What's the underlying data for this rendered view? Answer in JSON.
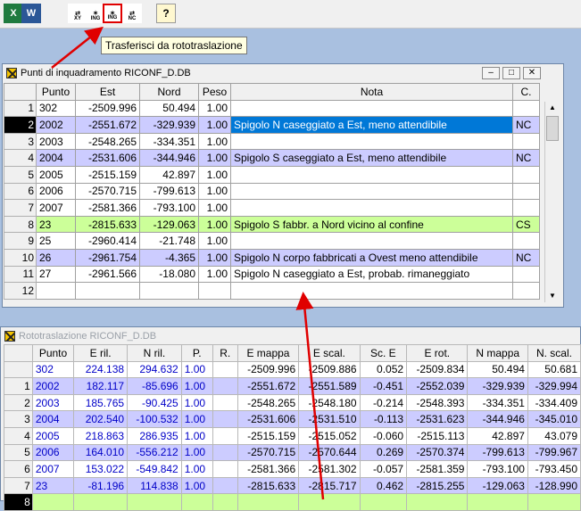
{
  "toolbar": {
    "buttons": [
      {
        "name": "excel-icon",
        "caption": "X"
      },
      {
        "name": "word-icon",
        "caption": "W"
      },
      {
        "name": "xy-icon",
        "caption": "XY"
      },
      {
        "name": "ing-icon",
        "caption": "ING"
      },
      {
        "name": "transfer-roto-icon",
        "caption": "ING"
      },
      {
        "name": "nc-icon",
        "caption": "NC"
      },
      {
        "name": "help-icon",
        "caption": "?"
      }
    ],
    "tooltip": "Trasferisci da rototraslazione"
  },
  "window1": {
    "title": "Punti di inquadramento RICONF_D.DB",
    "columns": [
      "Punto",
      "Est",
      "Nord",
      "Peso",
      "Nota",
      "C."
    ],
    "rows": [
      {
        "n": "1",
        "punto": "302",
        "est": "-2509.996",
        "nord": "50.494",
        "peso": "1.00",
        "nota": "",
        "c": ""
      },
      {
        "n": "2",
        "punto": "2002",
        "est": "-2551.672",
        "nord": "-329.939",
        "peso": "1.00",
        "nota": "Spigolo N caseggiato a Est, meno attendibile",
        "c": "NC"
      },
      {
        "n": "3",
        "punto": "2003",
        "est": "-2548.265",
        "nord": "-334.351",
        "peso": "1.00",
        "nota": "",
        "c": ""
      },
      {
        "n": "4",
        "punto": "2004",
        "est": "-2531.606",
        "nord": "-344.946",
        "peso": "1.00",
        "nota": "Spigolo S caseggiato a Est, meno attendibile",
        "c": "NC"
      },
      {
        "n": "5",
        "punto": "2005",
        "est": "-2515.159",
        "nord": "42.897",
        "peso": "1.00",
        "nota": "",
        "c": ""
      },
      {
        "n": "6",
        "punto": "2006",
        "est": "-2570.715",
        "nord": "-799.613",
        "peso": "1.00",
        "nota": "",
        "c": ""
      },
      {
        "n": "7",
        "punto": "2007",
        "est": "-2581.366",
        "nord": "-793.100",
        "peso": "1.00",
        "nota": "",
        "c": ""
      },
      {
        "n": "8",
        "punto": "23",
        "est": "-2815.633",
        "nord": "-129.063",
        "peso": "1.00",
        "nota": "Spigolo S fabbr. a Nord vicino al confine",
        "c": "CS"
      },
      {
        "n": "9",
        "punto": "25",
        "est": "-2960.414",
        "nord": "-21.748",
        "peso": "1.00",
        "nota": "",
        "c": ""
      },
      {
        "n": "10",
        "punto": "26",
        "est": "-2961.754",
        "nord": "-4.365",
        "peso": "1.00",
        "nota": "Spigolo N corpo fabbricati a Ovest meno attendibile",
        "c": "NC"
      },
      {
        "n": "11",
        "punto": "27",
        "est": "-2961.566",
        "nord": "-18.080",
        "peso": "1.00",
        "nota": "Spigolo N caseggiato a Est, probab. rimaneggiato",
        "c": ""
      },
      {
        "n": "12",
        "punto": "",
        "est": "",
        "nord": "",
        "peso": "",
        "nota": "",
        "c": ""
      }
    ]
  },
  "window2": {
    "title": "Rototraslazione RICONF_D.DB",
    "columns": [
      "Punto",
      "E ril.",
      "N ril.",
      "P.",
      "R.",
      "E mappa",
      "E scal.",
      "Sc. E",
      "E rot.",
      "N mappa",
      "N. scal."
    ],
    "rows": [
      {
        "n": "",
        "v": [
          "302",
          "224.138",
          "294.632",
          "1.00",
          "",
          "-2509.996",
          "-2509.886",
          "0.052",
          "-2509.834",
          "50.494",
          "50.681"
        ]
      },
      {
        "n": "1",
        "v": [
          "2002",
          "182.117",
          "-85.696",
          "1.00",
          "",
          "-2551.672",
          "-2551.589",
          "-0.451",
          "-2552.039",
          "-329.939",
          "-329.994"
        ]
      },
      {
        "n": "2",
        "v": [
          "2003",
          "185.765",
          "-90.425",
          "1.00",
          "",
          "-2548.265",
          "-2548.180",
          "-0.214",
          "-2548.393",
          "-334.351",
          "-334.409"
        ]
      },
      {
        "n": "3",
        "v": [
          "2004",
          "202.540",
          "-100.532",
          "1.00",
          "",
          "-2531.606",
          "-2531.510",
          "-0.113",
          "-2531.623",
          "-344.946",
          "-345.010"
        ]
      },
      {
        "n": "4",
        "v": [
          "2005",
          "218.863",
          "286.935",
          "1.00",
          "",
          "-2515.159",
          "-2515.052",
          "-0.060",
          "-2515.113",
          "42.897",
          "43.079"
        ]
      },
      {
        "n": "5",
        "v": [
          "2006",
          "164.010",
          "-556.212",
          "1.00",
          "",
          "-2570.715",
          "-2570.644",
          "0.269",
          "-2570.374",
          "-799.613",
          "-799.967"
        ]
      },
      {
        "n": "6",
        "v": [
          "2007",
          "153.022",
          "-549.842",
          "1.00",
          "",
          "-2581.366",
          "-2581.302",
          "-0.057",
          "-2581.359",
          "-793.100",
          "-793.450"
        ]
      },
      {
        "n": "7",
        "v": [
          "23",
          "-81.196",
          "114.838",
          "1.00",
          "",
          "-2815.633",
          "-2815.717",
          "0.462",
          "-2815.255",
          "-129.063",
          "-128.990"
        ]
      }
    ],
    "partial_row": {
      "n": "8"
    }
  }
}
